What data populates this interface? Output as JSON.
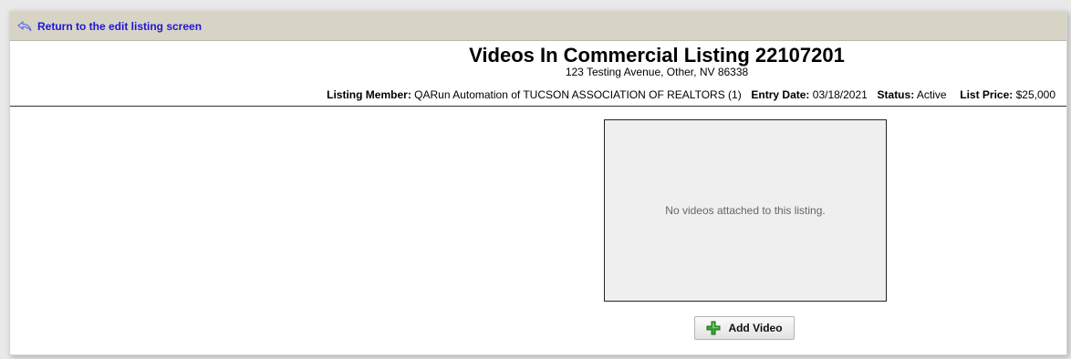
{
  "nav": {
    "return_label": "Return to the edit listing screen"
  },
  "header": {
    "title": "Videos In Commercial Listing 22107201",
    "address": "123 Testing Avenue, Other, NV 86338",
    "listing_member_label": "Listing Member:",
    "listing_member_value": "QARun Automation of TUCSON ASSOCIATION OF REALTORS (1)",
    "entry_date_label": "Entry Date:",
    "entry_date_value": "03/18/2021",
    "status_label": "Status:",
    "status_value": "Active",
    "list_price_label": "List Price:",
    "list_price_value": "$25,000"
  },
  "videos": {
    "empty_message": "No videos attached to this listing.",
    "add_label": "Add Video"
  },
  "colors": {
    "link": "#1d16d6",
    "bar_bg": "#d7d4c6",
    "plus_green": "#3aa634"
  },
  "icons": {
    "return": "return-arrow-icon",
    "add": "plus-icon"
  }
}
